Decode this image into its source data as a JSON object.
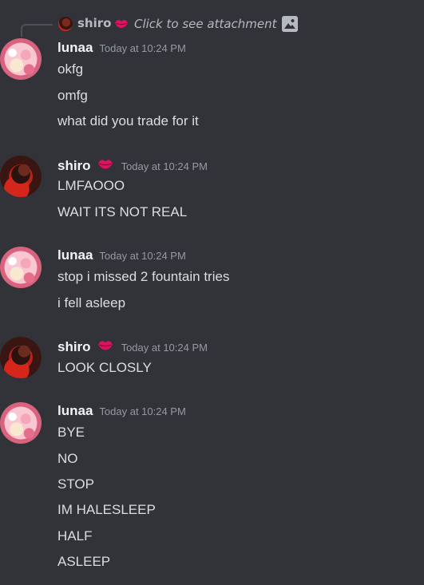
{
  "reply": {
    "username": "shiro",
    "text": "Click to see attachment",
    "badge_icon": "kiss-lips-icon",
    "attachment_icon": "image-icon"
  },
  "messages": [
    {
      "username": "lunaa",
      "timestamp": "Today at 10:24 PM",
      "has_badge": false,
      "lines": [
        "okfg",
        "omfg",
        "what did you trade for it"
      ]
    },
    {
      "username": "shiro",
      "timestamp": "Today at 10:24 PM",
      "has_badge": true,
      "badge_icon": "kiss-lips-icon",
      "lines": [
        "LMFAOOO",
        "WAIT ITS NOT REAL"
      ]
    },
    {
      "username": "lunaa",
      "timestamp": "Today at 10:24 PM",
      "has_badge": false,
      "lines": [
        "stop i missed 2 fountain tries",
        "i fell asleep"
      ]
    },
    {
      "username": "shiro",
      "timestamp": "Today at 10:24 PM",
      "has_badge": true,
      "badge_icon": "kiss-lips-icon",
      "lines": [
        "LOOK CLOSLY"
      ]
    },
    {
      "username": "lunaa",
      "timestamp": "Today at 10:24 PM",
      "has_badge": false,
      "lines": [
        "BYE",
        "NO",
        "STOP",
        "IM HALESLEEP",
        "HALF",
        "ASLEEP"
      ]
    }
  ],
  "colors": {
    "background": "#313338",
    "username": "#f2f3f5",
    "message_text": "#dbdee1",
    "timestamp": "#949ba4",
    "badge": "#e0115f"
  }
}
